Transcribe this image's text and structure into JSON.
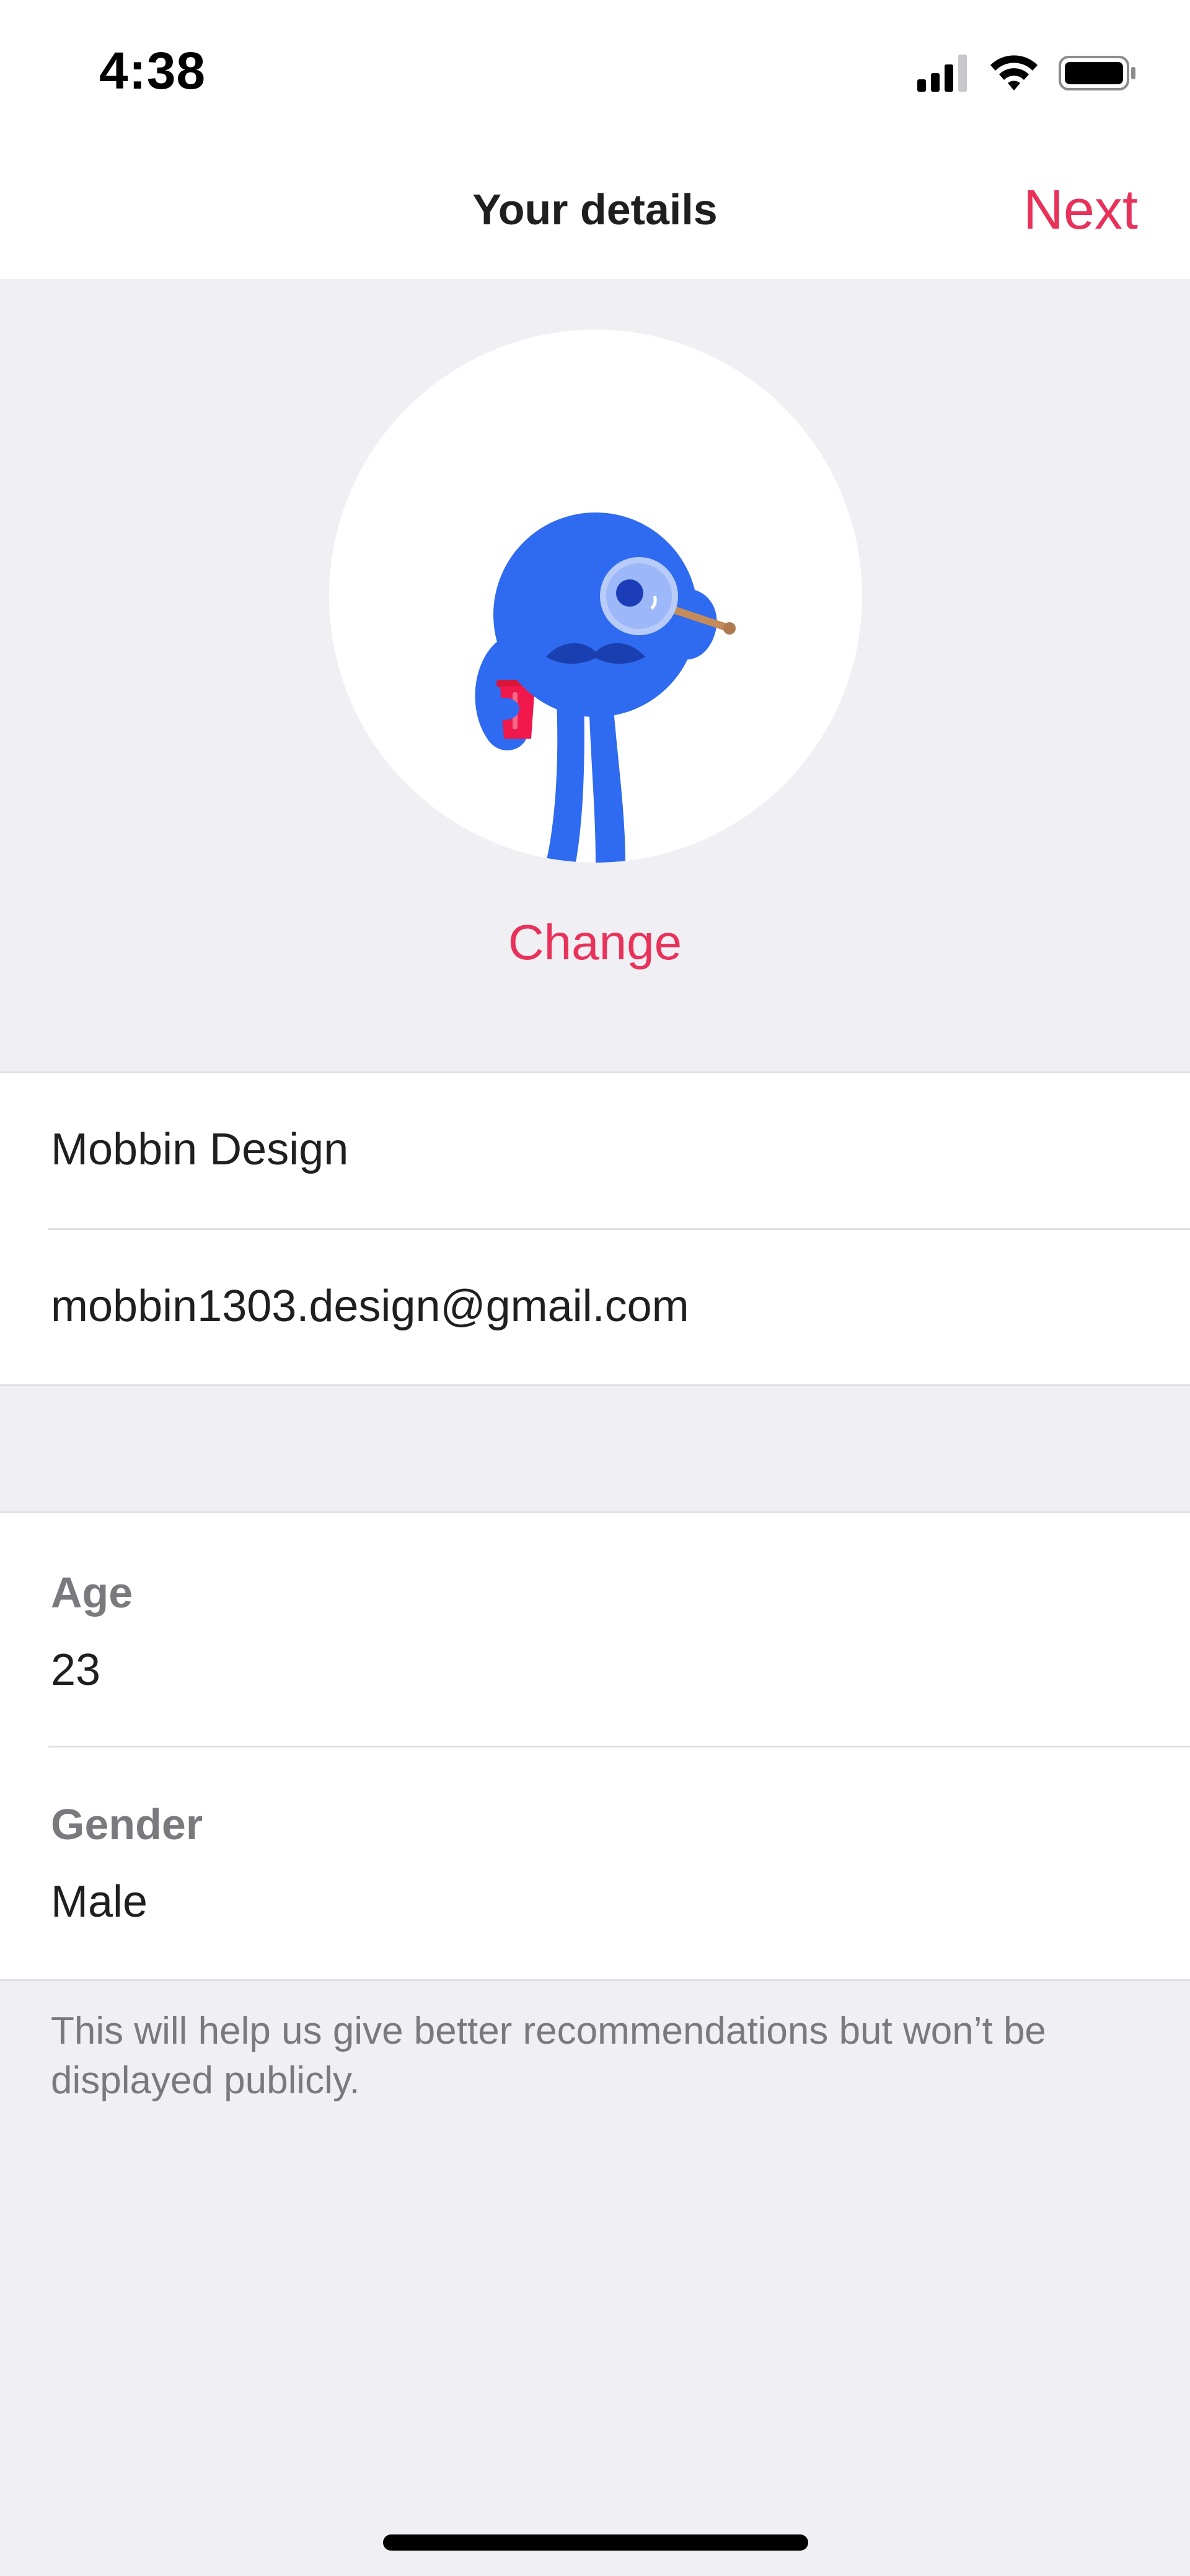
{
  "status_bar": {
    "time": "4:38",
    "icons": [
      "signal-icon",
      "wifi-icon",
      "battery-icon"
    ]
  },
  "nav": {
    "title": "Your details",
    "next_label": "Next"
  },
  "avatar": {
    "illustration": "blue-monster-with-monocle",
    "change_label": "Change"
  },
  "account": {
    "name": "Mobbin Design",
    "email": "mobbin1303.design@gmail.com"
  },
  "profile": {
    "age_label": "Age",
    "age_value": "23",
    "gender_label": "Gender",
    "gender_value": "Male"
  },
  "footnote": "This will help us give better recommendations but won’t be displayed publicly.",
  "colors": {
    "accent": "#E8325A",
    "background": "#EFEFF4",
    "surface": "#FFFFFF",
    "label": "#7A7A7E",
    "illustration_blue": "#2F6BF0"
  }
}
